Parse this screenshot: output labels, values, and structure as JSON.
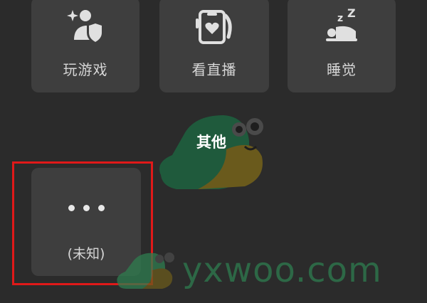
{
  "activities": [
    {
      "label": "玩游戏",
      "icon": "game-shield-icon"
    },
    {
      "label": "看直播",
      "icon": "live-stream-phone-icon"
    },
    {
      "label": "睡觉",
      "icon": "sleep-zzz-icon"
    }
  ],
  "section": {
    "title": "其他"
  },
  "unknown_item": {
    "label": "(未知)",
    "icon": "more-dots-icon"
  },
  "watermark": {
    "text": "yxwoo.com"
  },
  "colors": {
    "background": "#2b2b2b",
    "card": "#3e3e3e",
    "highlight": "#e01919",
    "mascot_green": "#1f5a3c",
    "mascot_olive": "#6a5a1c",
    "watermark": "#2e7d4f"
  }
}
